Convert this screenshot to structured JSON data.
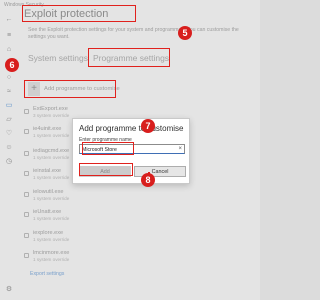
{
  "window": {
    "title": "Windows Security"
  },
  "page": {
    "title": "Exploit protection",
    "description": "See the Exploit protection settings for your system and programmes. You can customise the settings you want."
  },
  "tabs": [
    {
      "label": "System settings",
      "selected": false
    },
    {
      "label": "Programme settings",
      "selected": true
    }
  ],
  "add_programme": {
    "label": "Add programme to customise"
  },
  "programmes": [
    {
      "name": "ExtExport.exe",
      "sub": "3 system override"
    },
    {
      "name": "ie4uinit.exe",
      "sub": "1 system override"
    },
    {
      "name": "iediagcmd.exe",
      "sub": "1 system override"
    },
    {
      "name": "ieinstal.exe",
      "sub": "1 system override"
    },
    {
      "name": "ielowutil.exe",
      "sub": "1 system override"
    },
    {
      "name": "ieUnatt.exe",
      "sub": "1 system override"
    },
    {
      "name": "iexplore.exe",
      "sub": "1 system override"
    },
    {
      "name": "lmcinmore.exe",
      "sub": "1 system override"
    }
  ],
  "export_link": "Export settings",
  "dialog": {
    "title": "Add programme to customise",
    "field_label": "Enter programme name",
    "field_value": "Microsoft Store",
    "clear_glyph": "×",
    "add_label": "Add",
    "cancel_label": "Cancel"
  },
  "annotations": [
    "5",
    "6",
    "7",
    "8"
  ],
  "colors": {
    "annotation_red": "#e0211d",
    "accent_blue": "#3f6fb5"
  },
  "icons": {
    "nav": [
      "menu-icon",
      "home-icon",
      "shield-icon",
      "person-icon",
      "wifi-icon",
      "app-browser-icon",
      "laptop-icon",
      "heart-icon",
      "family-icon",
      "history-icon"
    ],
    "bottom": "gear-icon"
  }
}
